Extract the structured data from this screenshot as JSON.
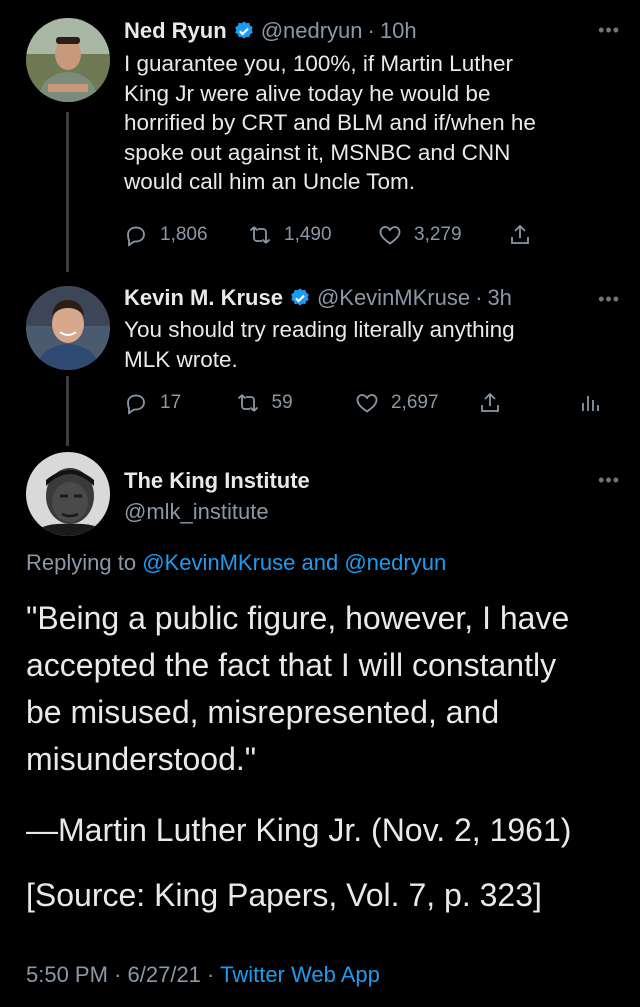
{
  "tweets": [
    {
      "name": "Ned Ryun",
      "handle": "@nedryun",
      "time": "10h",
      "text_lines": [
        "I guarantee you, 100%, if Martin Luther",
        "King Jr were alive today he would be",
        "horrified by CRT and BLM and if/when he",
        "spoke out against it, MSNBC and CNN",
        "would call him an Uncle Tom."
      ],
      "replies": "1,806",
      "retweets": "1,490",
      "likes": "3,279"
    },
    {
      "name": "Kevin M. Kruse",
      "handle": "@KevinMKruse",
      "time": "3h",
      "text_lines": [
        "You should try reading literally anything",
        "MLK wrote."
      ],
      "replies": "17",
      "retweets": "59",
      "likes": "2,697"
    }
  ],
  "main_tweet": {
    "name": "The King Institute",
    "handle": "@mlk_institute",
    "replying_prefix": "Replying to",
    "replying_user1": "@KevinMKruse",
    "replying_and": "and",
    "replying_user2": "@nedryun",
    "quote_lines": [
      "\"Being a public figure, however, I have",
      "accepted the fact that I will constantly",
      "be misused, misrepresented, and",
      "misunderstood.\""
    ],
    "attribution": "—Martin Luther King Jr. (Nov. 2, 1961)",
    "source": "[Source: King Papers, Vol. 7, p. 323]",
    "time": "5:50 PM",
    "date": "6/27/21",
    "app": "Twitter Web App"
  },
  "separator": "·",
  "more_icon": "more-icon",
  "colors": {
    "background": "#000000",
    "text": "#e7e9ea",
    "secondary": "#8b98a5",
    "link": "#1d9bf0",
    "verified": "#1d9bf0"
  }
}
